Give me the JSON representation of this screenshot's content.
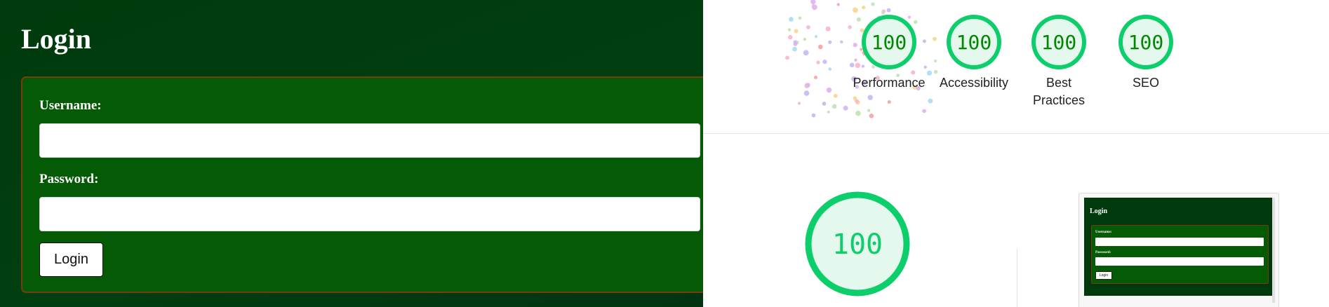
{
  "login": {
    "title": "Login",
    "username_label": "Username:",
    "username_value": "",
    "password_label": "Password:",
    "password_value": "",
    "submit_label": "Login"
  },
  "report": {
    "gauges": [
      {
        "score": "100",
        "label": "Performance"
      },
      {
        "score": "100",
        "label": "Accessibility"
      },
      {
        "score": "100",
        "label": "Best Practices"
      },
      {
        "score": "100",
        "label": "SEO"
      }
    ],
    "main_gauge": {
      "score": "100"
    },
    "thumbnail": {
      "title": "Login",
      "username_label": "Username:",
      "password_label": "Password:",
      "submit_label": "Login"
    }
  },
  "colors": {
    "gauge_pass_ring": "#0cce6b",
    "gauge_pass_fill": "#e5f8ed",
    "gauge_pass_text": "#008800",
    "login_background": "#013f10",
    "form_background": "#045a05",
    "form_border": "#7a3b10"
  }
}
